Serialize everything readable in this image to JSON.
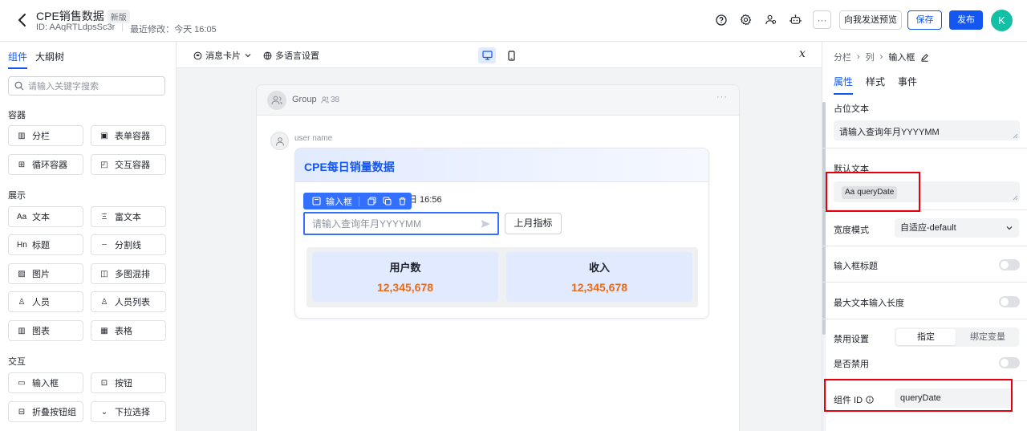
{
  "header": {
    "title": "CPE销售数据",
    "badge": "新版",
    "id_text": "ID: AAqRTLdpsSc3r",
    "last_modified": "最近修改：今天 16:05",
    "more_label": "···",
    "preview_label": "向我发送预览",
    "save_label": "保存",
    "publish_label": "发布",
    "avatar_initial": "K",
    "icons": [
      "help-icon",
      "settings-icon",
      "users-icon",
      "robot-icon"
    ]
  },
  "left_panel": {
    "tabs": [
      {
        "label": "组件",
        "active": true
      },
      {
        "label": "大纲树",
        "active": false
      }
    ],
    "search_placeholder": "请输入关键字搜索",
    "sections": [
      {
        "title": "容器",
        "items": [
          {
            "label": "分栏",
            "icon": "columns-icon"
          },
          {
            "label": "表单容器",
            "icon": "form-container-icon"
          },
          {
            "label": "循环容器",
            "icon": "loop-container-icon"
          },
          {
            "label": "交互容器",
            "icon": "interactive-container-icon"
          }
        ]
      },
      {
        "title": "展示",
        "items": [
          {
            "label": "文本",
            "icon": "text-icon"
          },
          {
            "label": "富文本",
            "icon": "rich-text-icon"
          },
          {
            "label": "标题",
            "icon": "heading-icon"
          },
          {
            "label": "分割线",
            "icon": "divider-icon"
          },
          {
            "label": "图片",
            "icon": "image-icon"
          },
          {
            "label": "多图混排",
            "icon": "multi-image-icon"
          },
          {
            "label": "人员",
            "icon": "person-icon"
          },
          {
            "label": "人员列表",
            "icon": "person-list-icon"
          },
          {
            "label": "图表",
            "icon": "chart-icon"
          },
          {
            "label": "表格",
            "icon": "table-icon"
          }
        ]
      },
      {
        "title": "交互",
        "items": [
          {
            "label": "输入框",
            "icon": "input-icon"
          },
          {
            "label": "按钮",
            "icon": "button-icon"
          },
          {
            "label": "折叠按钮组",
            "icon": "collapse-group-icon"
          },
          {
            "label": "下拉选择",
            "icon": "dropdown-icon"
          }
        ]
      }
    ]
  },
  "toolbar": {
    "card_type_label": "消息卡片",
    "i18n_label": "多语言设置",
    "fx_label": "𝑥"
  },
  "canvas": {
    "group_name": "Group",
    "member_count": "38",
    "more_label": "···",
    "user_name": "user name",
    "card": {
      "title": "CPE每日销量数据",
      "time_fragment": "日 16:56",
      "float_toolbar_label": "输入框",
      "input_placeholder": "请输入查询年月YYYYMM",
      "last_month_button": "上月指标",
      "metrics": [
        {
          "label": "用户数",
          "value": "12,345,678"
        },
        {
          "label": "收入",
          "value": "12,345,678"
        }
      ]
    }
  },
  "right_panel": {
    "breadcrumb": [
      "分栏",
      "列",
      "输入框"
    ],
    "tabs": [
      {
        "label": "属性",
        "active": true
      },
      {
        "label": "样式",
        "active": false
      },
      {
        "label": "事件",
        "active": false
      }
    ],
    "placeholder_label": "占位文本",
    "placeholder_value": "请输入查询年月YYYYMM",
    "default_text_label": "默认文本",
    "default_chip_prefix": "Aa",
    "default_text_value": "queryDate",
    "width_mode_label": "宽度模式",
    "width_mode_value": "自适应-default",
    "input_title_label": "输入框标题",
    "max_length_label": "最大文本输入长度",
    "disable_setting_label": "禁用设置",
    "disable_options": [
      {
        "label": "指定",
        "active": true
      },
      {
        "label": "绑定变量",
        "active": false
      }
    ],
    "is_disabled_label": "是否禁用",
    "component_id_label": "组件 ID",
    "component_id_value": "queryDate",
    "toggles": {
      "input_title": false,
      "max_length": false,
      "is_disabled": false
    }
  },
  "colors": {
    "primary": "#1456f0",
    "highlight": "#e6000e",
    "metric_value": "#e86b1a",
    "avatar": "#14c0a5"
  }
}
